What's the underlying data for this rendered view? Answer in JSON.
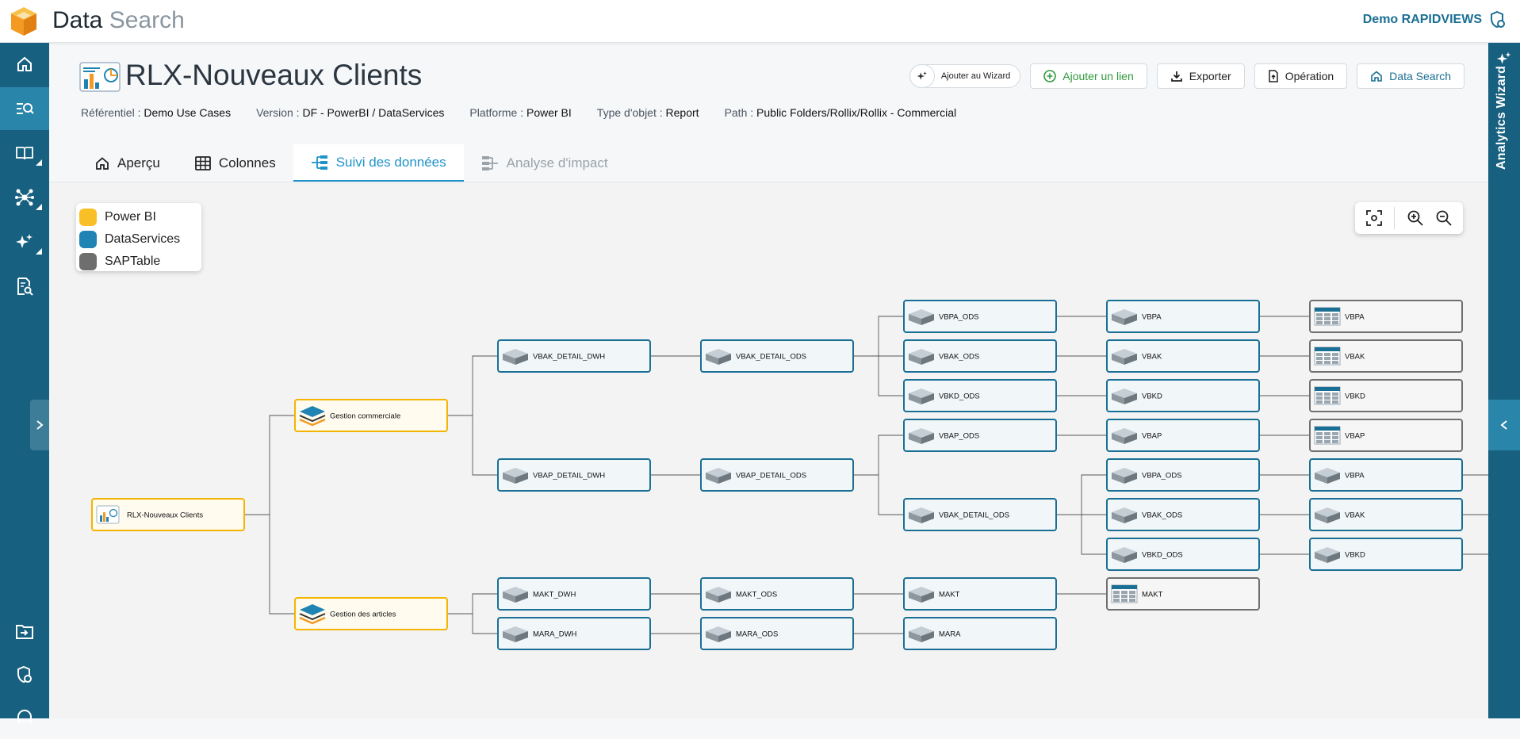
{
  "app": {
    "title_main": "Data",
    "title_light": "Search",
    "user": "Demo RAPIDVIEWS"
  },
  "sidebar": {
    "items": [
      {
        "icon": "home-icon"
      },
      {
        "icon": "search-list-icon",
        "active": true
      },
      {
        "icon": "book-icon",
        "submenu": true
      },
      {
        "icon": "network-icon",
        "submenu": true
      },
      {
        "icon": "sparkle-icon",
        "submenu": true
      },
      {
        "icon": "document-search-icon"
      },
      {
        "icon": "import-icon"
      },
      {
        "icon": "shield-gear-icon"
      },
      {
        "icon": "support-icon"
      }
    ]
  },
  "wizard_panel": {
    "label": "Analytics Wizard"
  },
  "page": {
    "title": "RLX-Nouveaux Clients",
    "actions": {
      "wizard": "Ajouter au Wizard",
      "add_link": "Ajouter un lien",
      "export": "Exporter",
      "operation": "Opération",
      "data_search": "Data Search"
    },
    "meta": [
      {
        "key": "Référentiel :",
        "value": "Demo Use Cases"
      },
      {
        "key": "Version :",
        "value": "DF - PowerBI / DataServices"
      },
      {
        "key": "Platforme :",
        "value": "Power BI"
      },
      {
        "key": "Type d'objet :",
        "value": "Report"
      },
      {
        "key": "Path :",
        "value": "Public Folders/Rollix/Rollix - Commercial"
      }
    ],
    "tabs": [
      {
        "label": "Aperçu",
        "icon": "home-icon"
      },
      {
        "label": "Colonnes",
        "icon": "grid-icon"
      },
      {
        "label": "Suivi des données",
        "icon": "lineage-icon",
        "active": true
      },
      {
        "label": "Analyse d'impact",
        "icon": "impact-icon",
        "disabled": true
      }
    ]
  },
  "legend": [
    {
      "label": "Power BI",
      "color": "#f9bf26"
    },
    {
      "label": "DataServices",
      "color": "#1f84b3"
    },
    {
      "label": "SAPTable",
      "color": "#6e6e6e"
    }
  ],
  "lineage": {
    "nodes": [
      {
        "id": "root",
        "label": "RLX-Nouveaux Clients",
        "type": "report"
      },
      {
        "id": "gc",
        "label": "Gestion commerciale",
        "type": "pbi"
      },
      {
        "id": "ga",
        "label": "Gestion des articles",
        "type": "pbi"
      },
      {
        "id": "vbak_detail_dwh",
        "label": "VBAK_DETAIL_DWH",
        "type": "ds"
      },
      {
        "id": "vbap_detail_dwh",
        "label": "VBAP_DETAIL_DWH",
        "type": "ds"
      },
      {
        "id": "makt_dwh",
        "label": "MAKT_DWH",
        "type": "ds"
      },
      {
        "id": "mara_dwh",
        "label": "MARA_DWH",
        "type": "ds"
      },
      {
        "id": "vbak_detail_ods",
        "label": "VBAK_DETAIL_ODS",
        "type": "ds"
      },
      {
        "id": "vbap_detail_ods",
        "label": "VBAP_DETAIL_ODS",
        "type": "ds"
      },
      {
        "id": "makt_ods",
        "label": "MAKT_ODS",
        "type": "ds"
      },
      {
        "id": "mara_ods",
        "label": "MARA_ODS",
        "type": "ds"
      },
      {
        "id": "vbpa_ods_a",
        "label": "VBPA_ODS",
        "type": "ds"
      },
      {
        "id": "vbak_ods_a",
        "label": "VBAK_ODS",
        "type": "ds"
      },
      {
        "id": "vbkd_ods_a",
        "label": "VBKD_ODS",
        "type": "ds"
      },
      {
        "id": "vbap_ods",
        "label": "VBAP_ODS",
        "type": "ds"
      },
      {
        "id": "vbak_detail_ods2",
        "label": "VBAK_DETAIL_ODS",
        "type": "ds"
      },
      {
        "id": "makt_c4",
        "label": "MAKT",
        "type": "ds"
      },
      {
        "id": "mara_c4",
        "label": "MARA",
        "type": "ds"
      },
      {
        "id": "vbpa_c5",
        "label": "VBPA",
        "type": "ds"
      },
      {
        "id": "vbak_c5",
        "label": "VBAK",
        "type": "ds"
      },
      {
        "id": "vbkd_c5",
        "label": "VBKD",
        "type": "ds"
      },
      {
        "id": "vbap_c5",
        "label": "VBAP",
        "type": "ds"
      },
      {
        "id": "vbpa_ods_b",
        "label": "VBPA_ODS",
        "type": "ds"
      },
      {
        "id": "vbak_ods_b",
        "label": "VBAK_ODS",
        "type": "ds"
      },
      {
        "id": "vbkd_ods_b",
        "label": "VBKD_ODS",
        "type": "ds"
      },
      {
        "id": "makt_sap",
        "label": "MAKT",
        "type": "sap"
      },
      {
        "id": "vbpa_sap",
        "label": "VBPA",
        "type": "sap"
      },
      {
        "id": "vbak_sap",
        "label": "VBAK",
        "type": "sap"
      },
      {
        "id": "vbkd_sap",
        "label": "VBKD",
        "type": "sap"
      },
      {
        "id": "vbap_sap",
        "label": "VBAP",
        "type": "sap"
      },
      {
        "id": "vbpa_c6",
        "label": "VBPA",
        "type": "ds"
      },
      {
        "id": "vbak_c6",
        "label": "VBAK",
        "type": "ds"
      },
      {
        "id": "vbkd_c6",
        "label": "VBKD",
        "type": "ds"
      }
    ]
  }
}
